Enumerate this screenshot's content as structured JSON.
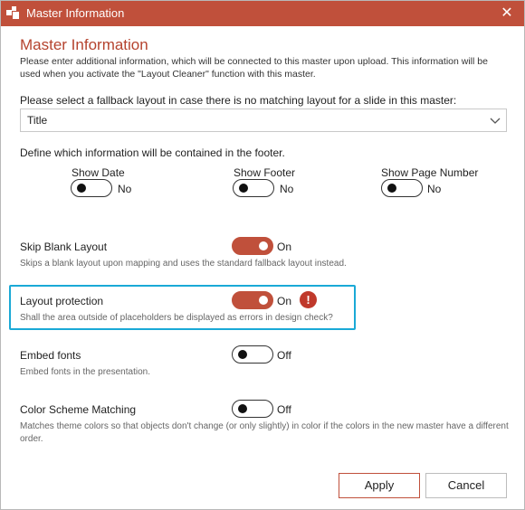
{
  "window": {
    "title": "Master Information"
  },
  "heading": "Master Information",
  "intro": "Please enter additional information, which will be connected to this master upon upload. This information will be used when you activate the \"Layout Cleaner\" function with this master.",
  "fallback": {
    "label": "Please select a fallback layout in case there is no matching layout for a slide in this master:",
    "selected": "Title"
  },
  "footer": {
    "label": "Define which information will be contained in the footer.",
    "options": [
      {
        "label": "Show Date",
        "state": "No"
      },
      {
        "label": "Show Footer",
        "state": "No"
      },
      {
        "label": "Show Page Number",
        "state": "No"
      }
    ]
  },
  "settings": [
    {
      "title": "Skip Blank Layout",
      "state": "On",
      "desc": "Skips a blank layout upon mapping and uses the standard fallback layout instead."
    },
    {
      "title": "Layout protection",
      "state": "On",
      "desc": "Shall the area outside of placeholders be displayed as errors in design check?"
    },
    {
      "title": "Embed fonts",
      "state": "Off",
      "desc": "Embed fonts in the presentation."
    },
    {
      "title": "Color Scheme Matching",
      "state": "Off",
      "desc": "Matches theme colors so that objects don't change (or only slightly) in color if the colors in the new master have a different order."
    }
  ],
  "warning_glyph": "!",
  "buttons": {
    "apply": "Apply",
    "cancel": "Cancel"
  },
  "colors": {
    "accent": "#c0503b",
    "highlight": "#1aa9d6",
    "warning": "#c0392b"
  }
}
